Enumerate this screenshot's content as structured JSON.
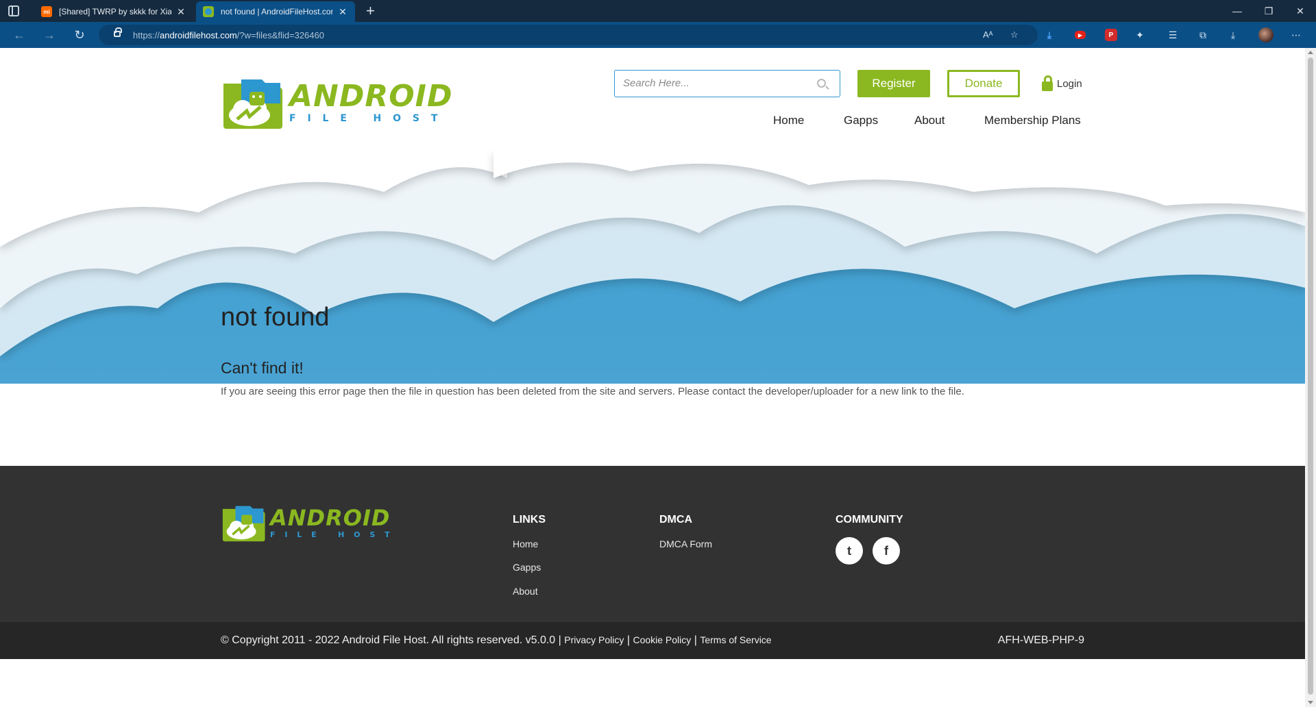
{
  "browser": {
    "tabs": [
      {
        "title": "[Shared] TWRP by skkk for Xiaomi",
        "favicon": "mi"
      },
      {
        "title": "not found | AndroidFileHost.com",
        "favicon": "afh"
      }
    ],
    "url_prefix": "https://",
    "url_domain": "androidfilehost.com",
    "url_path": "/?w=files&flid=326460"
  },
  "header": {
    "logo_main": "ANDROID",
    "logo_sub": "F I L E   H O S T",
    "search_placeholder": "Search Here...",
    "register_label": "Register",
    "donate_label": "Donate",
    "login_label": "Login",
    "nav": [
      "Home",
      "Gapps",
      "About",
      "Membership Plans"
    ]
  },
  "main": {
    "title": "not found",
    "subtitle": "Can't find it!",
    "message": "If you are seeing this error page then the file in question has been deleted from the site and servers. Please contact the developer/uploader for a new link to the file."
  },
  "footer": {
    "logo_main": "ANDROID",
    "logo_sub": "F I L E   H O S T",
    "links_title": "LINKS",
    "links": [
      "Home",
      "Gapps",
      "About"
    ],
    "dmca_title": "DMCA",
    "dmca_link": "DMCA Form",
    "community_title": "COMMUNITY",
    "twitter_glyph": "t",
    "facebook_glyph": "f"
  },
  "bottom": {
    "copyright": "© Copyright 2011 - 2022 Android File Host. All rights reserved. v5.0.0 |",
    "privacy": "Privacy Policy",
    "cookie": "Cookie Policy",
    "terms": "Terms of Service",
    "sep": "|",
    "server_id": "AFH-WEB-PHP-9"
  },
  "colors": {
    "brand_green": "#8bb820",
    "brand_blue": "#2d97d0",
    "footer_bg": "#323232",
    "bottom_bg": "#262626"
  }
}
